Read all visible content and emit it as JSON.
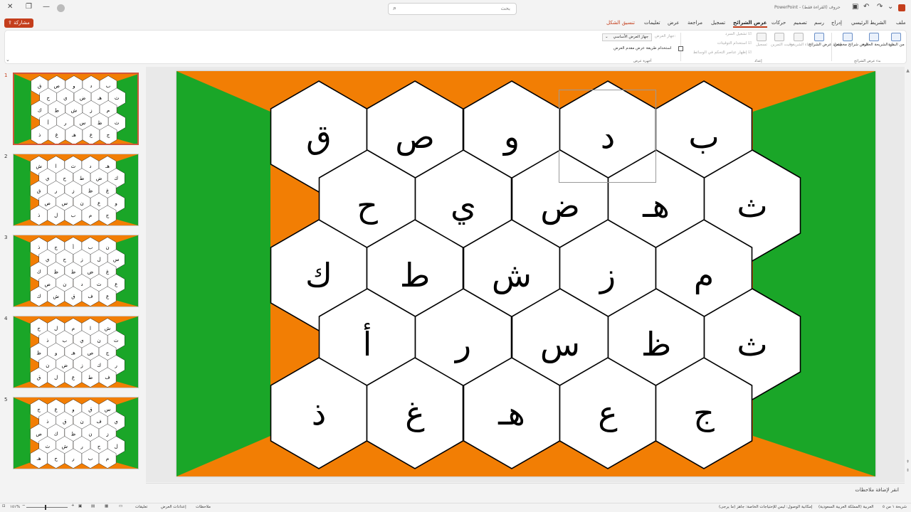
{
  "titlebar": {
    "search_placeholder": "بحث",
    "app_name": "PowerPoint",
    "document_title": "حروف (القراءة فقط)"
  },
  "share_label": "مشاركة",
  "tabs": [
    "ملف",
    "الشريط الرئيسي",
    "إدراج",
    "رسم",
    "تصميم",
    "حركات",
    "عرض الشرائح",
    "تسجيل",
    "مراجعة",
    "عرض",
    "تعليمات",
    "تنسيق الشكل"
  ],
  "active_tab": "عرض الشرائح",
  "ribbon": {
    "buttons": {
      "from_beginning": "من البداية",
      "from_current": "من الشريحة الحالية",
      "custom_show": "عرض شرائح مخصص",
      "setup": "إعداد عرض الشرائح",
      "hide_slide": "إخفاء الشريحة",
      "rehearse": "توقيت التمرين",
      "record": "تسجيل",
      "play_narrations": "تشغيل السرد",
      "use_timings": "استخدام التوقيتات",
      "show_media_controls": "إظهار عناصر التحكم في الوسائط"
    },
    "groups": {
      "start": "بدء عرض الشرائح",
      "setup": "إعداد",
      "monitors": "أجهزة عرض"
    },
    "monitor_label": "جهاز العرض:",
    "monitor_value": "جهاز العرض الأساسي",
    "presenter_view": "استخدام طريقة عرض مقدم العرض"
  },
  "slides": [
    {
      "number": "1",
      "rows": [
        [
          "ق",
          "ص",
          "و",
          "د",
          "ب"
        ],
        [
          "ح",
          "ي",
          "ض",
          "هـ",
          "ث"
        ],
        [
          "ك",
          "ط",
          "ش",
          "ز",
          "م"
        ],
        [
          "أ",
          "ر",
          "س",
          "ظ",
          "ث"
        ],
        [
          "ذ",
          "غ",
          "هـ",
          "ع",
          "ج"
        ]
      ]
    },
    {
      "number": "2",
      "rows": [
        [
          "ش",
          "ا",
          "ث",
          "د",
          "هـ"
        ],
        [
          "ي",
          "ح",
          "ط",
          "ض",
          "ك"
        ],
        [
          "ق",
          "ر",
          "ز",
          "ظ",
          "غ"
        ],
        [
          "ص",
          "س",
          "ن",
          "ع",
          "و"
        ],
        [
          "ذ",
          "ل",
          "ب",
          "م",
          "ج"
        ]
      ]
    },
    {
      "number": "3",
      "rows": [
        [
          "ذ",
          "ج",
          "أ",
          "ب",
          "ن"
        ],
        [
          "ي",
          "ح",
          "ز",
          "ل",
          "س"
        ],
        [
          "ك",
          "ظ",
          "ط",
          "ض",
          "غ"
        ],
        [
          "ص",
          "ن",
          "د",
          "ث",
          "ع"
        ],
        [
          "ك",
          "ش",
          "ق",
          "ف",
          "ع"
        ]
      ]
    },
    {
      "number": "4",
      "rows": [
        [
          "ح",
          "ل",
          "م",
          "ا",
          "ش"
        ],
        [
          "ذ",
          "ب",
          "ي",
          "ن",
          "ث"
        ],
        [
          "ظ",
          "و",
          "هـ",
          "ص",
          "ج"
        ],
        [
          "ن",
          "ض",
          "ز",
          "ك",
          "ر"
        ],
        [
          "ق",
          "ل",
          "ع",
          "ط",
          "ف"
        ]
      ]
    },
    {
      "number": "5",
      "rows": [
        [
          "ج",
          "ع",
          "و",
          "ق",
          "س"
        ],
        [
          "ذ",
          "ق",
          "ن",
          "ف",
          "ي"
        ],
        [
          "ص",
          "ك",
          "ظ",
          "ن",
          "ز"
        ],
        [
          "ث",
          "ش",
          "ر",
          "ح",
          "ل"
        ],
        [
          "هـ",
          "ح",
          "ر",
          "ب",
          "م"
        ]
      ]
    }
  ],
  "current_slide": 1,
  "notes_placeholder": "انقر لإضافة ملاحظات",
  "status": {
    "slide_counter": "شريحة ١ من ٥",
    "language": "العربية (المملكة العربية السعودية)",
    "accessibility": "إمكانية الوصول: ليس للإحتياجات الخاصة: جاهز (ما يرجى)",
    "notes_button": "ملاحظات",
    "display_settings": "إعدادات العرض",
    "comments": "تعليقات",
    "zoom": "١٥١%"
  },
  "colors": {
    "accent": "#c43e1c",
    "green": "#1aa628",
    "orange": "#f27e04",
    "hex_fill": "#ffffff",
    "hex_stroke": "#000000"
  }
}
